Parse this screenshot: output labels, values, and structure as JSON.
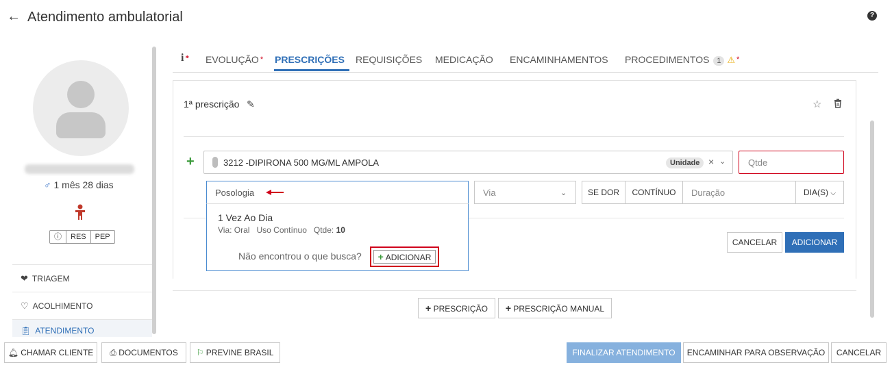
{
  "header": {
    "title": "Atendimento ambulatorial",
    "back_icon": "arrow-left-icon",
    "help_icon": "question-circle-icon"
  },
  "patient": {
    "age": "1 mês 28 dias",
    "sex_icon": "male-icon",
    "badges": [
      "RES",
      "PEP"
    ]
  },
  "sidebar": {
    "items": [
      {
        "label": "TRIAGEM",
        "icon": "heartbeat-icon"
      },
      {
        "label": "ACOLHIMENTO",
        "icon": "heart-icon"
      },
      {
        "label": "ATENDIMENTO",
        "icon": "clipboard-icon",
        "active": true
      }
    ]
  },
  "tabs": [
    {
      "label": "EVOLUÇÃO",
      "required": true
    },
    {
      "label": "PRESCRIÇÕES",
      "active": true
    },
    {
      "label": "REQUISIÇÕES"
    },
    {
      "label": "MEDICAÇÃO"
    },
    {
      "label": "ENCAMINHAMENTOS"
    },
    {
      "label": "PROCEDIMENTOS",
      "count": "1",
      "warning": true,
      "required": true
    }
  ],
  "tab_required_mark": "*",
  "prescription": {
    "title": "1ª prescrição",
    "medication": "3212 -DIPIRONA 500 MG/ML AMPOLA",
    "unit": "Unidade",
    "qtde_placeholder": "Qtde",
    "posologia_placeholder": "Posologia",
    "via_placeholder": "Via",
    "se_dor_label": "SE DOR",
    "continuo_label": "CONTÍNUO",
    "duracao_placeholder": "Duração",
    "dias_label": "DIA(S)",
    "cancel_label": "CANCELAR",
    "add_label": "ADICIONAR"
  },
  "dropdown": {
    "option_title": "1 Vez Ao Dia",
    "option_via": "Via: Oral",
    "option_uso": "Uso Contínuo",
    "option_qtde_label": "Qtde:",
    "option_qtde_value": "10",
    "not_found": "Não encontrou o que busca?",
    "add_label": "ADICIONAR"
  },
  "add_buttons": {
    "prescricao": "PRESCRIÇÃO",
    "prescricao_manual": "PRESCRIÇÃO MANUAL"
  },
  "footer": {
    "chamar_cliente": "CHAMAR CLIENTE",
    "documentos": "DOCUMENTOS",
    "previne_brasil": "PREVINE BRASIL",
    "finalizar": "FINALIZAR ATENDIMENTO",
    "encaminhar": "ENCAMINHAR PARA OBSERVAÇÃO",
    "cancelar": "CANCELAR"
  },
  "colors": {
    "accent": "#2f6fb7",
    "required": "#d0021b",
    "success": "#3a9a3a",
    "warning": "#e8a900"
  }
}
